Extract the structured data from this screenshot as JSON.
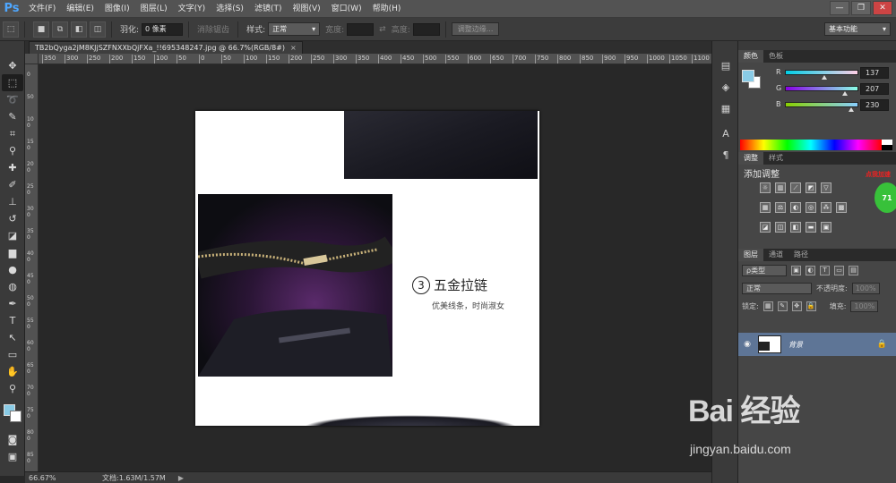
{
  "app": {
    "logo": "Ps"
  },
  "menu": [
    "文件(F)",
    "编辑(E)",
    "图像(I)",
    "图层(L)",
    "文字(Y)",
    "选择(S)",
    "滤镜(T)",
    "视图(V)",
    "窗口(W)",
    "帮助(H)"
  ],
  "window_controls": {
    "minimize": "—",
    "restore": "❐",
    "close": "✕"
  },
  "options": {
    "feather_label": "羽化:",
    "feather_value": "0 像素",
    "antialias_label": "消除锯齿",
    "style_label": "样式:",
    "style_value": "正常",
    "width_label": "宽度:",
    "height_label": "高度:",
    "refine_edge": "调整边缘...",
    "workspace": "基本功能"
  },
  "document": {
    "tab_title": "TB2bQyga2jM8KJjSZFNXXbQjFXa_!!695348247.jpg @ 66.7%(RGB/8#)",
    "tab_close": "×",
    "feature_number": "3",
    "feature_title": "五金拉链",
    "feature_subtitle": "优美线条，时尚淑女"
  },
  "ruler_top": [
    "350",
    "300",
    "250",
    "200",
    "150",
    "100",
    "50",
    "0",
    "50",
    "100",
    "150",
    "200",
    "250",
    "300",
    "350",
    "400",
    "450",
    "500",
    "550",
    "600",
    "650",
    "700",
    "750",
    "800",
    "850",
    "900",
    "950",
    "1000",
    "1050",
    "1100"
  ],
  "ruler_left": [
    "0",
    "50",
    "100",
    "150",
    "200",
    "250",
    "300",
    "350",
    "400",
    "450",
    "500",
    "550",
    "600",
    "650",
    "700",
    "750",
    "800",
    "850",
    "900"
  ],
  "status": {
    "zoom": "66.67%",
    "doc_info": "文档:1.63M/1.57M",
    "arrow": "▶"
  },
  "color_panel": {
    "tabs": [
      "颜色",
      "色板"
    ],
    "r_label": "R",
    "r_value": "137",
    "g_label": "G",
    "g_value": "207",
    "b_label": "B",
    "b_value": "230",
    "fg_color": "#89cbe6"
  },
  "adjust_panel": {
    "tabs": [
      "调整",
      "样式"
    ],
    "title": "添加调整",
    "ad_text": "点我加速",
    "ad_number": "71"
  },
  "layers_panel": {
    "tabs": [
      "图层",
      "通道",
      "路径"
    ],
    "filter_label": "ρ类型",
    "blend_mode": "正常",
    "opacity_label": "不透明度:",
    "opacity_value": "100%",
    "lock_label": "锁定:",
    "fill_label": "填充:",
    "fill_value": "100%",
    "layer_name": "背景"
  },
  "watermark": {
    "logo": "Bai 经验",
    "url": "jingyan.baidu.com"
  }
}
